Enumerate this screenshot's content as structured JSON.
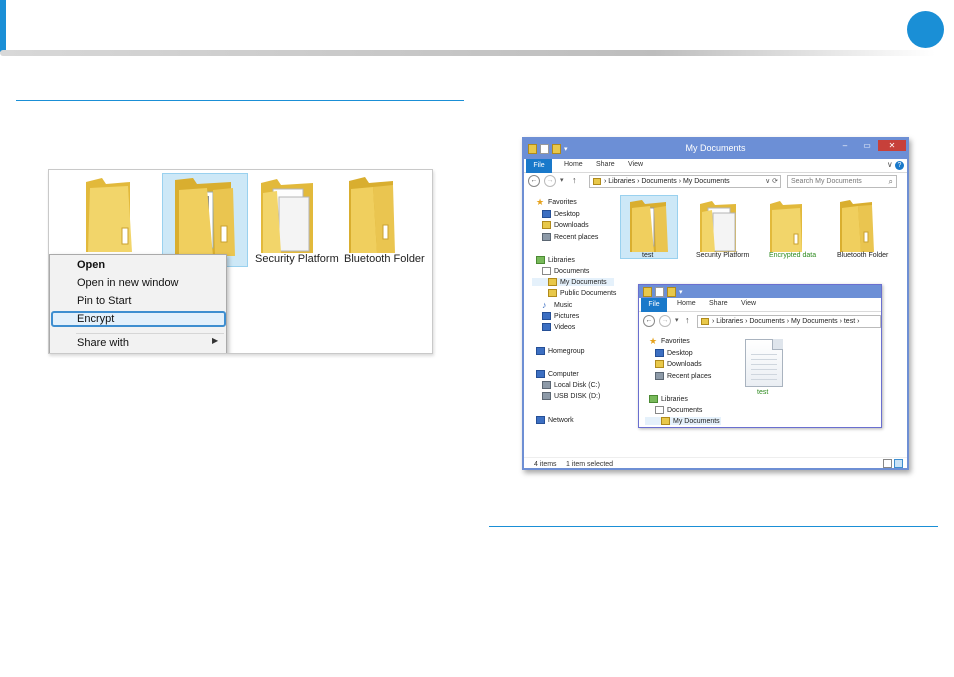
{
  "left_shot": {
    "folders": [
      {
        "label": ""
      },
      {
        "label": ""
      },
      {
        "label": "Security Platform"
      },
      {
        "label": "Bluetooth Folder"
      }
    ],
    "context_menu": {
      "items": [
        "Open",
        "Open in new window",
        "Pin to Start",
        "Encrypt",
        "Share with"
      ]
    }
  },
  "window": {
    "title": "My Documents",
    "min": "–",
    "max": "▭",
    "close": "✕",
    "tabs": {
      "file": "File",
      "home": "Home",
      "share": "Share",
      "view": "View"
    },
    "ribbon_right": "∨",
    "help": "?",
    "back": "←",
    "forward": "→",
    "down": "▾",
    "up": "↑",
    "address": "›  Libraries  ›  Documents  ›  My Documents",
    "address_tools": "∨  ⟳",
    "search_placeholder": "Search My Documents",
    "search_icon": "⌕",
    "nav": {
      "favorites": "Favorites",
      "desktop": "Desktop",
      "downloads": "Downloads",
      "recent": "Recent places",
      "libraries": "Libraries",
      "documents": "Documents",
      "my_documents": "My Documents",
      "public_documents": "Public Documents",
      "music": "Music",
      "pictures": "Pictures",
      "videos": "Videos",
      "homegroup": "Homegroup",
      "computer": "Computer",
      "local_disk": "Local Disk (C:)",
      "usb_disk": "USB DISK (D:)",
      "network": "Network"
    },
    "items": [
      {
        "label": "test"
      },
      {
        "label": "Security Platform"
      },
      {
        "label": "Encrypted data"
      },
      {
        "label": "Bluetooth Folder"
      }
    ],
    "status": {
      "count": "4 items",
      "selected": "1 item selected"
    }
  },
  "inner_window": {
    "tabs": {
      "file": "File",
      "home": "Home",
      "share": "Share",
      "view": "View"
    },
    "address": "›  Libraries  ›  Documents  ›  My Documents  ›  test  ›",
    "nav": {
      "favorites": "Favorites",
      "desktop": "Desktop",
      "downloads": "Downloads",
      "recent": "Recent places",
      "libraries": "Libraries",
      "documents": "Documents",
      "my_documents": "My Documents"
    },
    "file_label": "test"
  },
  "colors": {
    "accent": "#1a8fd6",
    "titlebar": "#6c8fd6",
    "file_tab": "#1979ca",
    "encrypted_label": "#2d8a1e"
  }
}
